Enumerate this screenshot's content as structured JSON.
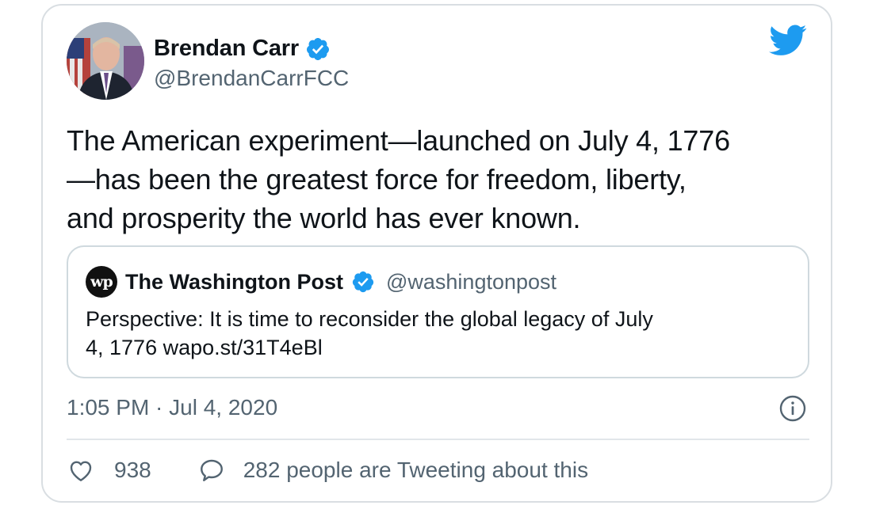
{
  "author": {
    "name": "Brendan Carr",
    "handle": "@BrendanCarrFCC",
    "verified": true
  },
  "tweet": {
    "text_lines": [
      "The American experiment—launched on July 4, 1776",
      "—has been the greatest force for freedom, liberty,",
      "and prosperity the world has ever known."
    ]
  },
  "quoted": {
    "name": "The Washington Post",
    "handle": "@washingtonpost",
    "logo_text": "wp",
    "text_lines": [
      "Perspective: It is time to reconsider the global legacy of July",
      "4, 1776 wapo.st/31T4eBl"
    ]
  },
  "meta": {
    "timestamp": "1:05 PM · Jul 4, 2020"
  },
  "actions": {
    "like_count": "938",
    "reply_text": "282 people are Tweeting about this"
  },
  "icons": {
    "twitter": "twitter-bird-icon",
    "verified": "verified-badge-icon",
    "info": "info-icon",
    "like": "heart-icon",
    "reply": "speech-bubble-icon"
  },
  "colors": {
    "twitter_blue": "#1d9bf0",
    "text_primary": "#0f1419",
    "text_secondary": "#536471",
    "border": "#cfd9de"
  }
}
